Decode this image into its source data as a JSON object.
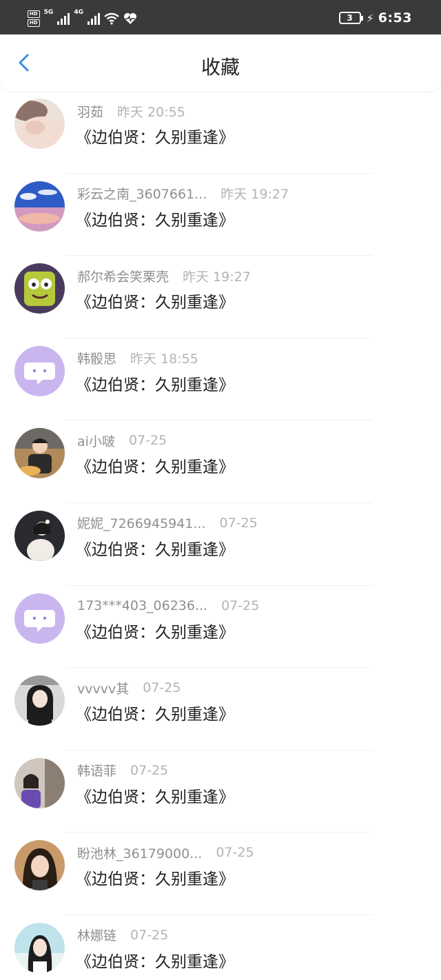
{
  "status_bar": {
    "hd1": "HD",
    "hd2": "HD",
    "net1": "5G",
    "net2": "4G",
    "battery": "3",
    "time": "6:53"
  },
  "header": {
    "title": "收藏"
  },
  "items": [
    {
      "name": "羽茹",
      "time": "昨天 20:55",
      "book": "《边伯贤：久别重逢》"
    },
    {
      "name": "彩云之南_3607661...",
      "time": "昨天 19:27",
      "book": "《边伯贤：久别重逢》"
    },
    {
      "name": "郝尔希会笑栗壳",
      "time": "昨天 19:27",
      "book": "《边伯贤：久别重逢》"
    },
    {
      "name": "韩骰思",
      "time": "昨天 18:55",
      "book": "《边伯贤：久别重逢》"
    },
    {
      "name": "ai小啵",
      "time": "07-25",
      "book": "《边伯贤：久别重逢》"
    },
    {
      "name": "妮妮_7266945941...",
      "time": "07-25",
      "book": "《边伯贤：久别重逢》"
    },
    {
      "name": "173***403_06236...",
      "time": "07-25",
      "book": "《边伯贤：久别重逢》"
    },
    {
      "name": "vvvvv其",
      "time": "07-25",
      "book": "《边伯贤：久别重逢》"
    },
    {
      "name": "韩语菲",
      "time": "07-25",
      "book": "《边伯贤：久别重逢》"
    },
    {
      "name": "盼池林_36179000...",
      "time": "07-25",
      "book": "《边伯贤：久别重逢》"
    },
    {
      "name": "林娜链",
      "time": "07-25",
      "book": "《边伯贤：久别重逢》"
    }
  ]
}
